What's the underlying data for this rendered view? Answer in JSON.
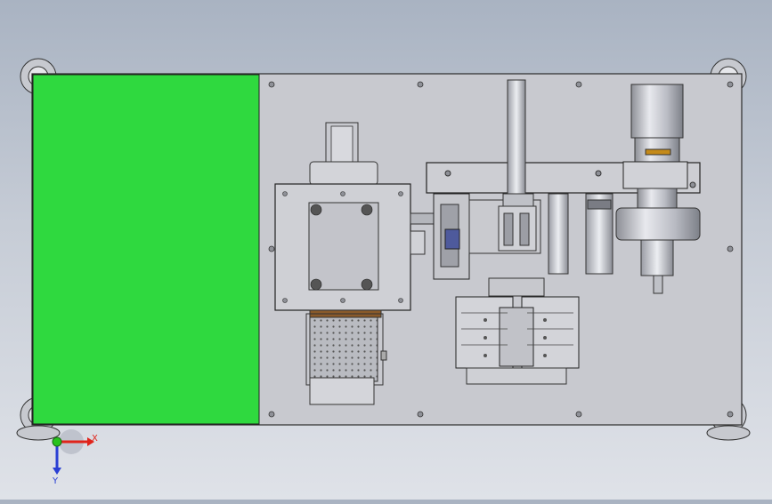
{
  "viewport": {
    "background_top": "#a9b3c2",
    "background_bottom": "#dfe2e8"
  },
  "model": {
    "highlight_color": "#2fd93f",
    "plate_color": "#c8c9cf",
    "edge_color": "#2b2b2b"
  },
  "triad": {
    "x_label": "X",
    "y_label": "Y",
    "x_color": "#e0241b",
    "y_color": "#2a3fd4",
    "origin_color": "#27c21c"
  }
}
